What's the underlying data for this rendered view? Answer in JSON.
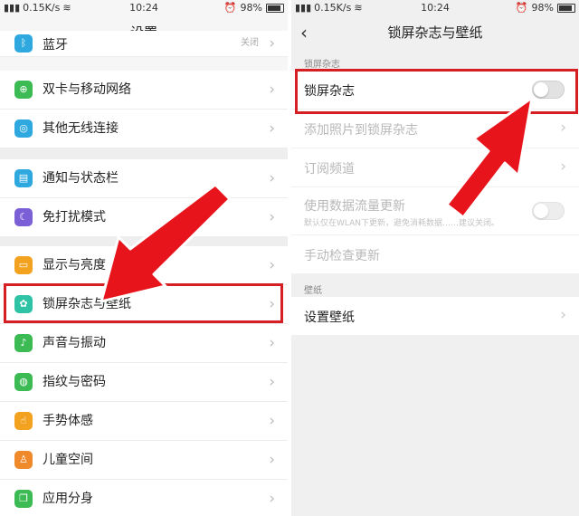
{
  "left": {
    "status": {
      "speed": "0.15K/s",
      "time": "10:24",
      "battery": "98%"
    },
    "title": "设置",
    "rows": [
      {
        "label": "蓝牙",
        "value": "关闭",
        "icon": "bluetooth-icon",
        "color": "#2fa8e0"
      },
      {
        "label": "双卡与移动网络",
        "icon": "network-icon",
        "color": "#3cba54"
      },
      {
        "label": "其他无线连接",
        "icon": "wireless-icon",
        "color": "#2fa8e0"
      },
      {
        "label": "通知与状态栏",
        "icon": "notification-icon",
        "color": "#2fa8e0"
      },
      {
        "label": "免打扰模式",
        "icon": "moon-icon",
        "color": "#7b5fd6"
      },
      {
        "label": "显示与亮度",
        "icon": "display-icon",
        "color": "#f2a21e"
      },
      {
        "label": "锁屏杂志与壁纸",
        "icon": "flower-icon",
        "color": "#2fc3a6"
      },
      {
        "label": "声音与振动",
        "icon": "sound-icon",
        "color": "#3cba54"
      },
      {
        "label": "指纹与密码",
        "icon": "fingerprint-icon",
        "color": "#3cba54"
      },
      {
        "label": "手势体感",
        "icon": "hand-icon",
        "color": "#f2a21e"
      },
      {
        "label": "儿童空间",
        "icon": "child-icon",
        "color": "#f0892a"
      },
      {
        "label": "应用分身",
        "icon": "clone-icon",
        "color": "#3cba54"
      }
    ]
  },
  "right": {
    "status": {
      "speed": "0.15K/s",
      "time": "10:24",
      "battery": "98%"
    },
    "title": "锁屏杂志与壁纸",
    "section1": "锁屏杂志",
    "rows": [
      {
        "label": "锁屏杂志",
        "type": "toggle",
        "on": false
      },
      {
        "label": "添加照片到锁屏杂志",
        "type": "chevron",
        "disabled": true
      },
      {
        "label": "订阅频道",
        "type": "chevron",
        "disabled": true
      },
      {
        "label": "使用数据流量更新",
        "sub": "默认仅在WLAN下更新，避免消耗数据",
        "sub2": "建议关闭。",
        "type": "toggle",
        "disabled": true,
        "on": false
      },
      {
        "label": "手动检查更新",
        "type": "none",
        "disabled": true
      }
    ],
    "section2": "壁纸",
    "wallpaper": "设置壁纸"
  },
  "colors": {
    "highlight": "#d61e25",
    "arrow": "#e8141c"
  }
}
